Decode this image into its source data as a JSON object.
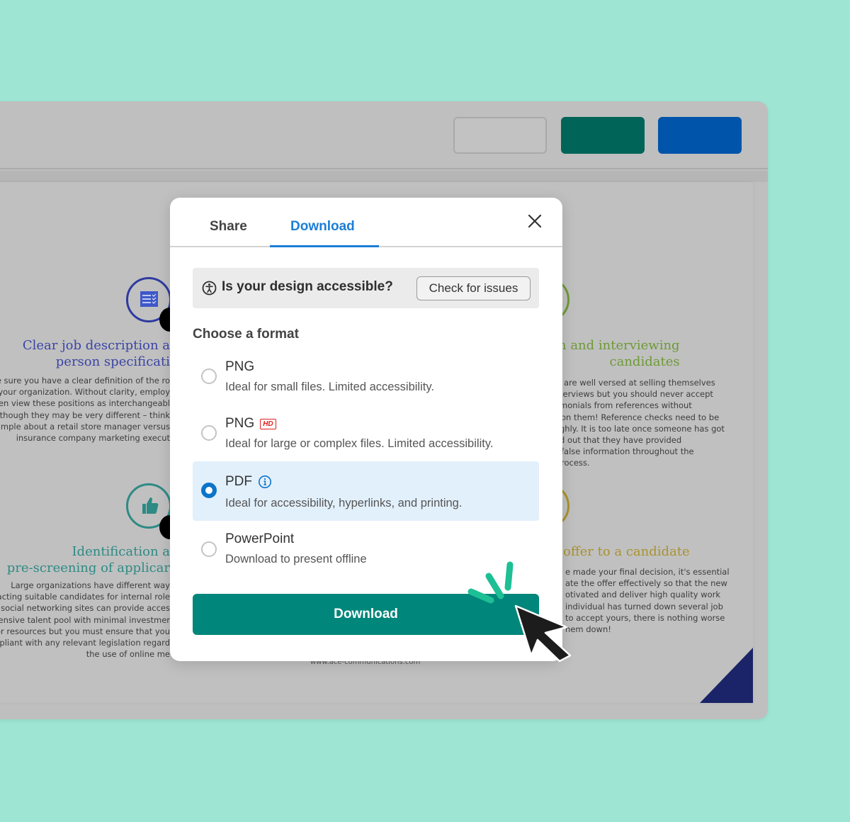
{
  "background_app": {
    "toolbar_buttons": [
      {
        "name": "outline",
        "color": "#c2c2c2"
      },
      {
        "name": "primary",
        "color": "#006558"
      },
      {
        "name": "secondary",
        "color": "#0054aa"
      }
    ],
    "document": {
      "sections": [
        {
          "heading_lines": [
            "Clear job description a",
            "person specificati"
          ],
          "heading_color": "#3b44a6",
          "icon": "checklist-icon",
          "body_lines": [
            "ake sure you have a clear definition of the ro",
            "in your organization. Without clarity, employ",
            "often view these positions as interchangeabl",
            "en though they may be very different – think",
            "example about a retail store manager versus",
            "insurance company marketing execut"
          ]
        },
        {
          "heading_lines": [
            "Identification a",
            "pre-screening of applicar"
          ],
          "heading_color": "#2e8a84",
          "icon": "thumbs-up-icon",
          "body_lines": [
            "Large organizations have different way",
            "ttracting suitable candidates for internal role",
            "ng social networking sites can provide acces",
            "xtensive talent pool with minimal investmer",
            "e or resources but you must ensure that you",
            "ompliant with any relevant legislation regard",
            "the use of online me"
          ]
        },
        {
          "heading_lines": [
            "n and interviewing",
            "candidates"
          ],
          "heading_color": "#6d9a35",
          "icon": "ring-icon",
          "body_lines": [
            "are well versed at selling themselves",
            "terviews but you should never accept",
            "monials from references without",
            "on them! Reference checks need to be",
            "ghly. It is too late once someone has got",
            "d out that they have provided",
            "false information throughout the",
            "rocess."
          ]
        },
        {
          "heading_lines": [
            "offer to a candidate"
          ],
          "heading_color": "#a9922e",
          "icon": "ring-icon",
          "body_lines": [
            "e made your final decision, it's essential",
            "ate the offer effectively so that the new",
            "otivated and deliver high quality work",
            "individual has turned down several job",
            "to accept yours, there is nothing worse",
            "hem down!"
          ]
        }
      ],
      "footer_url": "www.ace-communications.com"
    }
  },
  "modal": {
    "tabs": [
      {
        "label": "Share",
        "active": false
      },
      {
        "label": "Download",
        "active": true
      }
    ],
    "close_icon": "close-icon",
    "accessibility": {
      "question": "Is your design accessible?",
      "check_button": "Check for issues"
    },
    "format_label": "Choose a format",
    "formats": [
      {
        "title": "PNG",
        "badge": "",
        "description": "Ideal for small files. Limited accessibility.",
        "selected": false
      },
      {
        "title": "PNG",
        "badge": "HD",
        "description": "Ideal for large or complex files. Limited accessibility.",
        "selected": false
      },
      {
        "title": "PDF",
        "badge": "info",
        "description": "Ideal for accessibility, hyperlinks, and printing.",
        "selected": true
      },
      {
        "title": "PowerPoint",
        "badge": "",
        "description": "Download to present offline",
        "selected": false
      }
    ],
    "download_button": "Download"
  },
  "colors": {
    "accent_blue": "#1c7ed6",
    "download_green": "#00867a",
    "cursor_spark": "#1dbf95",
    "page_background": "#9fe5d4"
  }
}
